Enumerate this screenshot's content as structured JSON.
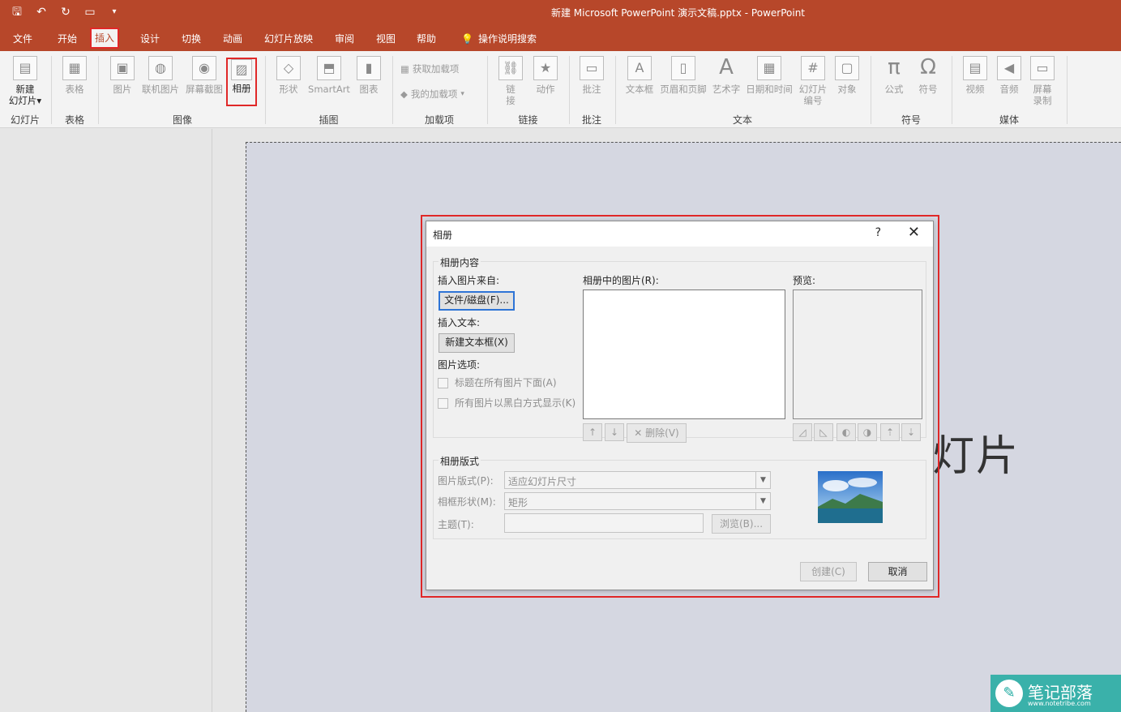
{
  "window": {
    "title": "新建 Microsoft PowerPoint 演示文稿.pptx  -  PowerPoint"
  },
  "qat": {
    "save_icon": "save-icon",
    "undo_icon": "undo-icon",
    "redo_icon": "redo-icon",
    "present_icon": "present-icon",
    "customize_icon": "chevron-down-icon"
  },
  "tabs": [
    {
      "label": "文件"
    },
    {
      "label": "开始"
    },
    {
      "label": "插入",
      "active": true
    },
    {
      "label": "设计"
    },
    {
      "label": "切换"
    },
    {
      "label": "动画"
    },
    {
      "label": "幻灯片放映"
    },
    {
      "label": "审阅"
    },
    {
      "label": "视图"
    },
    {
      "label": "帮助"
    }
  ],
  "tell_me": {
    "label": "操作说明搜索"
  },
  "ribbon": {
    "new_slide": {
      "line1": "新建",
      "line2": "幻灯片"
    },
    "table": "表格",
    "picture": "图片",
    "online_picture": "联机图片",
    "screenshot": "屏幕截图",
    "photo_album": "相册",
    "shapes": "形状",
    "smartart": "SmartArt",
    "chart": "图表",
    "get_addins": "获取加载项",
    "my_addins": "我的加载项",
    "link": {
      "line1": "链",
      "line2": "接"
    },
    "action": "动作",
    "comment": "批注",
    "textbox": "文本框",
    "header_footer": "页眉和页脚",
    "wordart": "艺术字",
    "datetime": "日期和时间",
    "slide_number": {
      "line1": "幻灯片",
      "line2": "编号"
    },
    "object": "对象",
    "equation": "公式",
    "symbol": "符号",
    "video": "视频",
    "audio": "音频",
    "screen_record": {
      "line1": "屏幕",
      "line2": "录制"
    },
    "groups": {
      "slides": "幻灯片",
      "tables": "表格",
      "images": "图像",
      "illustrations": "插图",
      "addins": "加载项",
      "links": "链接",
      "comments": "批注",
      "text": "文本",
      "symbols": "符号",
      "media": "媒体"
    }
  },
  "slide": {
    "visible_text": "灯片"
  },
  "dialog": {
    "title": "相册",
    "help": "?",
    "close": "✕",
    "album_content": "相册内容",
    "insert_from": "插入图片来自:",
    "file_disk": "文件/磁盘(F)...",
    "insert_text": "插入文本:",
    "new_textbox": "新建文本框(X)",
    "picture_options": "图片选项:",
    "captions_below": "标题在所有图片下面(A)",
    "black_white": "所有图片以黑白方式显示(K)",
    "pictures_in_album": "相册中的图片(R):",
    "preview": "预览:",
    "remove": "删除(V)",
    "album_layout": "相册版式",
    "picture_layout_label": "图片版式(P):",
    "picture_layout_value": "适应幻灯片尺寸",
    "frame_shape_label": "相框形状(M):",
    "frame_shape_value": "矩形",
    "theme_label": "主题(T):",
    "theme_value": "",
    "browse": "浏览(B)...",
    "create": "创建(C)",
    "cancel": "取消"
  },
  "watermark": {
    "name": "笔记部落",
    "url": "www.notetribe.com"
  },
  "colors": {
    "accent": "#b7472a",
    "highlight": "#e02828",
    "slide_bg": "#d5d7e1"
  }
}
